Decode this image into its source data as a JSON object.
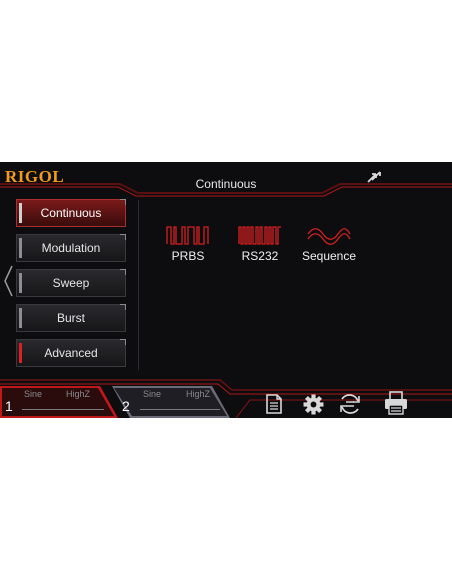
{
  "header": {
    "logo": "RIGOL",
    "title": "Continuous"
  },
  "menu": [
    {
      "label": "Continuous",
      "active": true
    },
    {
      "label": "Modulation",
      "active": false
    },
    {
      "label": "Sweep",
      "active": false
    },
    {
      "label": "Burst",
      "active": false
    },
    {
      "label": "Advanced",
      "active": false
    }
  ],
  "waveforms": [
    {
      "label": "PRBS",
      "icon": "prbs-wave-icon"
    },
    {
      "label": "RS232",
      "icon": "rs232-wave-icon"
    },
    {
      "label": "Sequence",
      "icon": "sequence-wave-icon"
    }
  ],
  "channels": [
    {
      "number": "1",
      "waveform": "Sine",
      "impedance": "HighZ",
      "color": "#d42020"
    },
    {
      "number": "2",
      "waveform": "Sine",
      "impedance": "HighZ",
      "color": "#8a8a9a"
    }
  ],
  "toolbar": [
    "document-icon",
    "gear-icon",
    "sync-icon",
    "printer-icon"
  ],
  "colors": {
    "accent": "#d42020",
    "logo": "#f29a1a",
    "background": "#0d0d0f"
  }
}
